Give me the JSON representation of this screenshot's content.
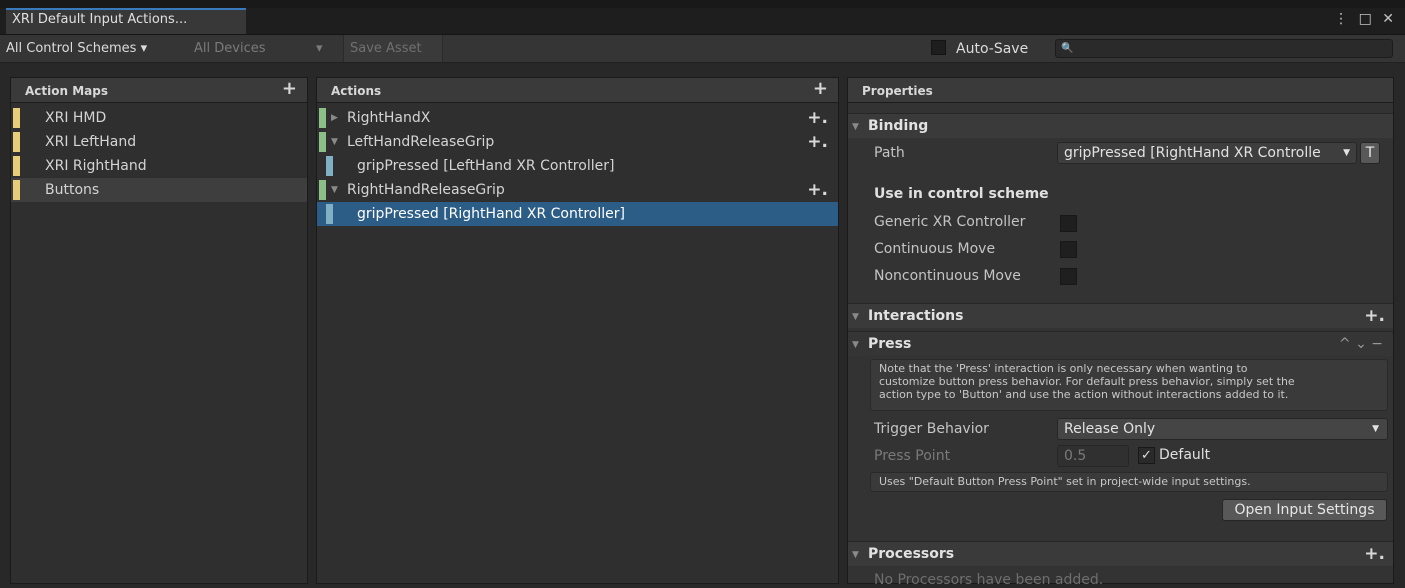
{
  "window": {
    "tab_title": "XRI Default Input Actions...",
    "controls": "⋮ □ ✕"
  },
  "toolbar": {
    "scheme": "All Control Schemes ▾",
    "devices": "All Devices",
    "devices_arrow": "▾",
    "save_asset": "Save Asset",
    "autosave": "Auto-Save",
    "search_icon": "🔍",
    "search_placeholder": ""
  },
  "action_maps": {
    "header": "Action Maps",
    "add_label": "+",
    "items": [
      "XRI HMD",
      "XRI LeftHand",
      "XRI RightHand",
      "Buttons"
    ]
  },
  "actions": {
    "header": "Actions",
    "add_label": "+",
    "row_add": "+.",
    "items": [
      {
        "label": "RightHandX",
        "kind": "action"
      },
      {
        "label": "LeftHandReleaseGrip",
        "kind": "action"
      },
      {
        "label": "gripPressed [LeftHand XR Controller]",
        "kind": "binding"
      },
      {
        "label": "RightHandReleaseGrip",
        "kind": "action"
      },
      {
        "label": "gripPressed [RightHand XR Controller]",
        "kind": "binding",
        "selected": true
      }
    ]
  },
  "properties": {
    "header": "Properties",
    "binding": {
      "title": "Binding",
      "path_label": "Path",
      "path_value": "gripPressed [RightHand XR Controlle",
      "path_t": "T",
      "use_in_scheme": "Use in control scheme",
      "schemes": [
        "Generic XR Controller",
        "Continuous Move",
        "Noncontinuous Move"
      ]
    },
    "interactions": {
      "title": "Interactions",
      "add": "+."
    },
    "press": {
      "title": "Press",
      "controls": "^  ⌄  −",
      "note_line1": "Note that the 'Press' interaction is only necessary when wanting to",
      "note_line2": "customize button press behavior. For default press behavior, simply set the",
      "note_line3": "action type to 'Button' and use the action without interactions added to it.",
      "trigger_label": "Trigger Behavior",
      "trigger_value": "Release Only",
      "press_point_label": "Press Point",
      "press_point_value": "0.5",
      "default_check": "✓",
      "default_label": "Default",
      "uses_note": "Uses \"Default Button Press Point\" set in project-wide input settings.",
      "open_settings": "Open Input Settings"
    },
    "processors": {
      "title": "Processors",
      "add": "+.",
      "empty": "No Processors have been added."
    }
  },
  "colors": {
    "accent": "#2c5d87",
    "map_marker": "#e9cc7a",
    "action_marker": "#8cbf87",
    "binding_marker": "#7fb0c4"
  }
}
